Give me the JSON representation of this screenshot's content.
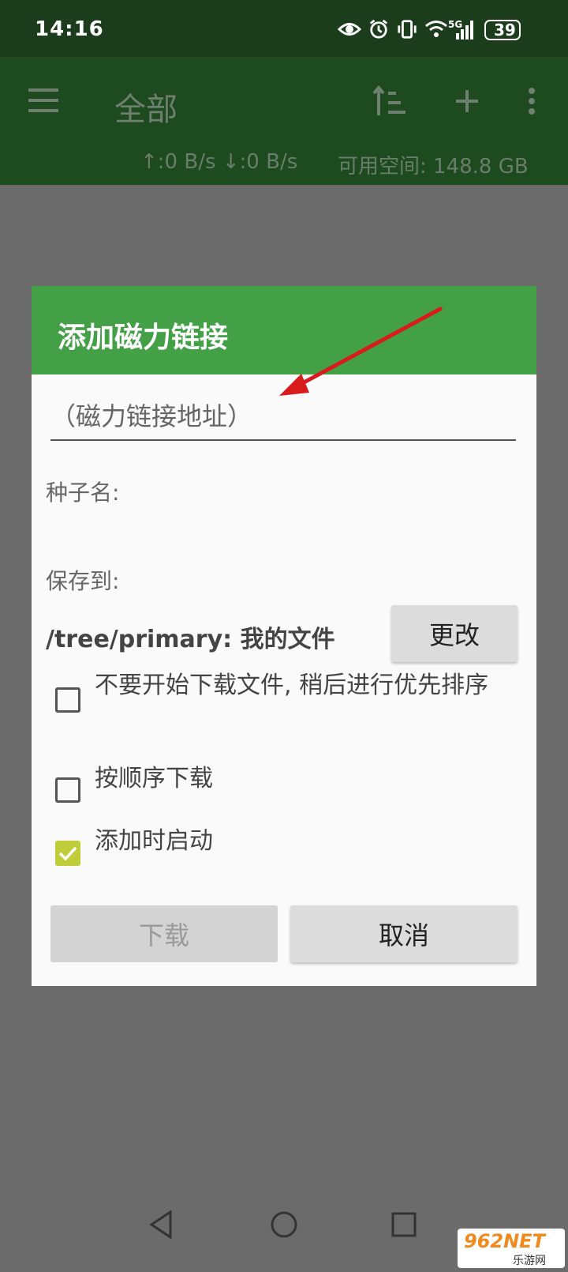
{
  "status_bar": {
    "time": "14:16",
    "network": "5G",
    "battery": "39"
  },
  "app_bar": {
    "title": "全部",
    "speed": "↑:0 B/s ↓:0 B/s",
    "free_space": "可用空间: 148.8 GB",
    "icons": [
      "menu-icon",
      "sort-icon",
      "add-icon",
      "more-icon"
    ]
  },
  "dialog": {
    "title": "添加磁力链接",
    "magnet_placeholder": "（磁力链接地址）",
    "torrent_name_label": "种子名:",
    "save_to_label": "保存到:",
    "save_path": "/tree/primary: 我的文件",
    "change_button": "更改",
    "options": [
      {
        "label": "不要开始下载文件, 稍后进行优先排序",
        "checked": false
      },
      {
        "label": "按顺序下载",
        "checked": false
      },
      {
        "label": "添加时启动",
        "checked": true
      }
    ],
    "download_button": "下载",
    "cancel_button": "取消"
  },
  "watermark": {
    "text": "962NET",
    "sub": "乐游网"
  },
  "colors": {
    "header_green": "#43a047",
    "checkbox_checked": "#c0cc3a",
    "arrow_red": "#d81b1b"
  }
}
